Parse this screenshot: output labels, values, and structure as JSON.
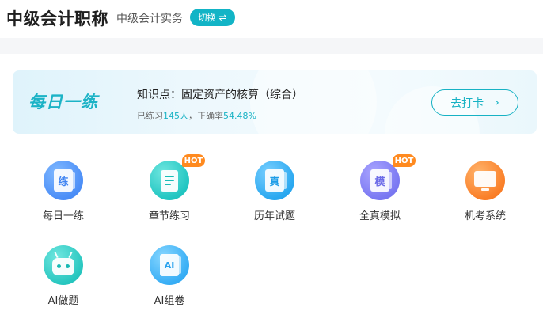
{
  "header": {
    "title": "中级会计职称",
    "subject": "中级会计实务",
    "switch_label": "切换",
    "switch_icon": "⇌"
  },
  "daily": {
    "logo": "每日一练",
    "topic": "知识点：固定资产的核算（综合）",
    "stats_prefix": "已练习",
    "practiced_count": "145人",
    "stats_mid": "，正确率",
    "accuracy": "54.48%",
    "go_label": "去打卡",
    "go_icon": "›"
  },
  "features": [
    {
      "label": "每日一练",
      "glyph": "练",
      "hot": ""
    },
    {
      "label": "章节练习",
      "glyph": "",
      "hot": "HOT"
    },
    {
      "label": "历年试题",
      "glyph": "真",
      "hot": ""
    },
    {
      "label": "全真模拟",
      "glyph": "模",
      "hot": "HOT"
    },
    {
      "label": "机考系统",
      "glyph": "",
      "hot": ""
    },
    {
      "label": "AI做题",
      "glyph": "",
      "hot": ""
    },
    {
      "label": "AI组卷",
      "glyph": "AI",
      "hot": ""
    }
  ],
  "colors": {
    "accent": "#17b2c4",
    "hot_badge": "#ff8a1f"
  }
}
